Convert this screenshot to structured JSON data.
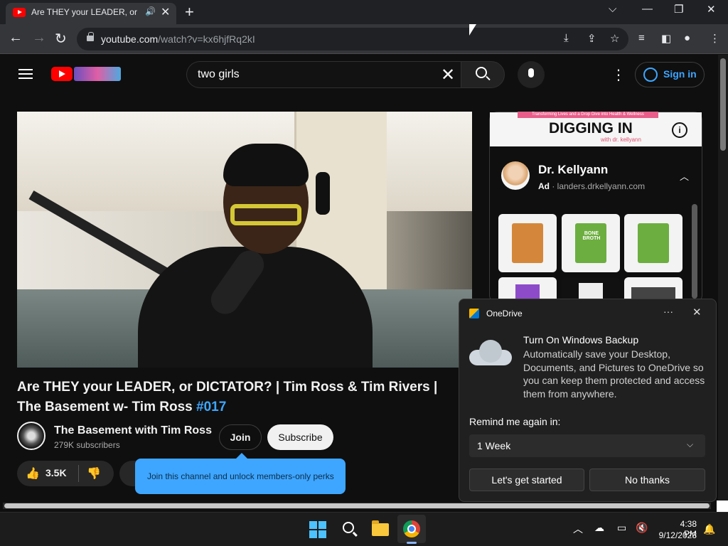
{
  "browser": {
    "tab_title": "Are THEY your LEADER, or DICTATOR? | Tim Ross & Tim Rivers | The Basement w- Tim Ross #017",
    "url_main": "youtube.com",
    "url_path": "/watch?v=kx6hjfRq2kI"
  },
  "youtube": {
    "search_query": "two girls",
    "sign_in": "Sign in",
    "video": {
      "title": "Are THEY your LEADER, or DICTATOR? | Tim Ross & Tim Rivers | The Basement w- Tim Ross",
      "hashtag": "#017",
      "channel": "The Basement with Tim Ross",
      "subscribers": "279K subscribers",
      "join_label": "Join",
      "subscribe_label": "Subscribe",
      "likes": "3.5K",
      "join_tooltip": "Join this channel and unlock members-only perks"
    },
    "ad": {
      "tagline": "Transforming Lives and a Drop Dive into Health & Wellness",
      "headline": "DIGGING IN",
      "subhead": "with dr. kellyann",
      "advertiser": "Dr. Kellyann",
      "ad_badge": "Ad",
      "domain": "landers.drkellyann.com",
      "product_label": "BONE BROTH"
    }
  },
  "onedrive": {
    "app_name": "OneDrive",
    "title": "Turn On Windows Backup",
    "body": "Automatically save your Desktop, Documents, and Pictures to OneDrive so you can keep them protected and access them from anywhere.",
    "remind_label": "Remind me again in:",
    "remind_value": "1 Week",
    "primary_button": "Let's get started",
    "secondary_button": "No thanks"
  },
  "taskbar": {
    "time": "4:38 PM",
    "date": "9/12/2023"
  }
}
